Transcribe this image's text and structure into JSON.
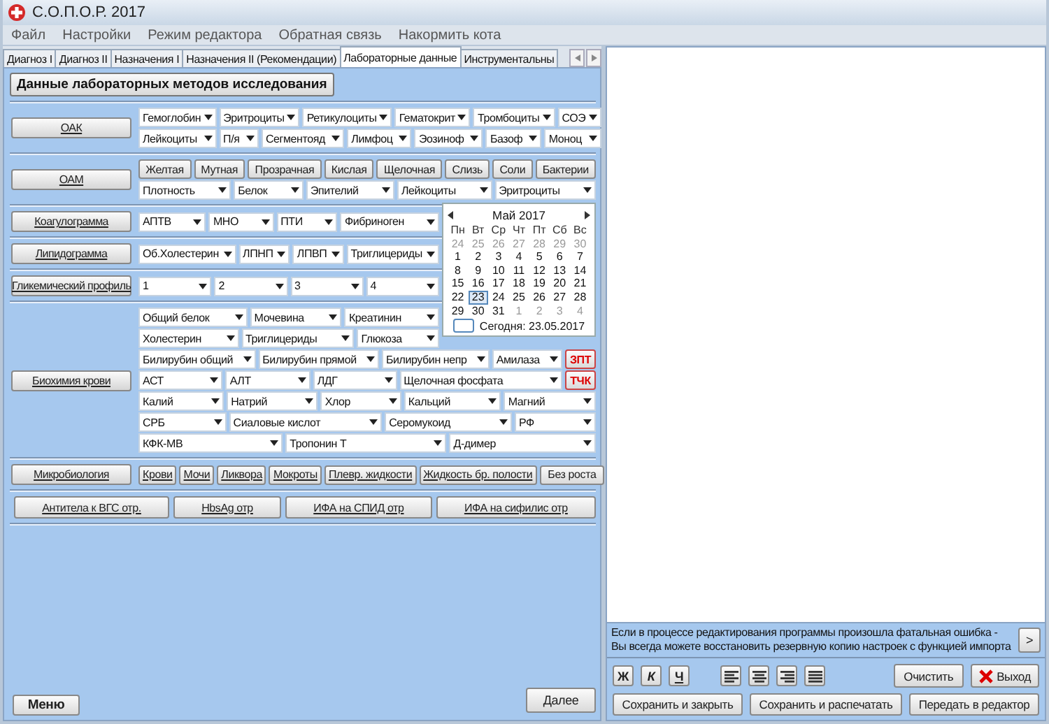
{
  "window": {
    "title": "С.О.П.О.Р. 2017"
  },
  "menu": [
    "Файл",
    "Настройки",
    "Режим редактора",
    "Обратная связь",
    "Накормить кота"
  ],
  "tabs": [
    {
      "label": "Диагноз I",
      "selected": false
    },
    {
      "label": "Диагноз II",
      "selected": false
    },
    {
      "label": "Назначения I",
      "selected": false
    },
    {
      "label": "Назначения II (Рекомендации)",
      "selected": false
    },
    {
      "label": "Лабораторные данные",
      "selected": true
    },
    {
      "label": "Инструментальны",
      "selected": false
    }
  ],
  "section_title": "Данные лабораторных методов исследования",
  "groups": [
    {
      "label": "ОАК",
      "rows": [
        {
          "items": [
            {
              "kind": "combo",
              "value": "Гемоглобин"
            },
            {
              "kind": "combo",
              "value": "Эритроциты"
            },
            {
              "kind": "combo",
              "value": "Ретикулоциты"
            },
            {
              "kind": "combo",
              "value": "Гематокрит"
            },
            {
              "kind": "combo",
              "value": "Тромбоциты"
            },
            {
              "kind": "combo",
              "value": "СОЭ"
            }
          ]
        },
        {
          "items": [
            {
              "kind": "combo",
              "value": "Лейкоциты"
            },
            {
              "kind": "combo",
              "value": "П/я"
            },
            {
              "kind": "combo",
              "value": "Сегментояд"
            },
            {
              "kind": "combo",
              "value": "Лимфоц"
            },
            {
              "kind": "combo",
              "value": "Эозиноф"
            },
            {
              "kind": "combo",
              "value": "Базоф"
            },
            {
              "kind": "combo",
              "value": "Моноц"
            }
          ]
        }
      ]
    },
    {
      "label": "ОАМ",
      "rows": [
        {
          "items": [
            {
              "kind": "toggle",
              "label": "Желтая"
            },
            {
              "kind": "toggle",
              "label": "Мутная"
            },
            {
              "kind": "toggle",
              "label": "Прозрачная"
            },
            {
              "kind": "toggle",
              "label": "Кислая"
            },
            {
              "kind": "toggle",
              "label": "Щелочная"
            },
            {
              "kind": "toggle",
              "label": "Слизь"
            },
            {
              "kind": "toggle",
              "label": "Соли"
            },
            {
              "kind": "toggle",
              "label": "Бактерии"
            }
          ]
        },
        {
          "items": [
            {
              "kind": "combo",
              "value": "Плотность"
            },
            {
              "kind": "combo",
              "value": "Белок"
            },
            {
              "kind": "combo",
              "value": "Эпителий"
            },
            {
              "kind": "combo",
              "value": "Лейкоциты"
            },
            {
              "kind": "combo",
              "value": "Эритроциты"
            }
          ]
        }
      ]
    },
    {
      "label": "Коагулограмма",
      "rows": [
        {
          "items": [
            {
              "kind": "combo",
              "value": "АПТВ"
            },
            {
              "kind": "combo",
              "value": "МНО"
            },
            {
              "kind": "combo",
              "value": "ПТИ"
            },
            {
              "kind": "combo",
              "value": "Фибриноген"
            }
          ]
        }
      ]
    },
    {
      "label": "Липидограмма",
      "rows": [
        {
          "items": [
            {
              "kind": "combo",
              "value": "Об.Холестерин"
            },
            {
              "kind": "combo",
              "value": "ЛПНП"
            },
            {
              "kind": "combo",
              "value": "ЛПВП"
            },
            {
              "kind": "combo",
              "value": "Триглицериды"
            }
          ]
        }
      ]
    },
    {
      "label": "Гликемический профиль",
      "rows": [
        {
          "items": [
            {
              "kind": "combo",
              "value": "1"
            },
            {
              "kind": "combo",
              "value": "2"
            },
            {
              "kind": "combo",
              "value": "3"
            },
            {
              "kind": "combo",
              "value": "4"
            }
          ]
        }
      ]
    },
    {
      "label": "Биохимия крови",
      "rows": [
        {
          "items": [
            {
              "kind": "combo",
              "value": "Общий белок"
            },
            {
              "kind": "combo",
              "value": "Мочевина"
            },
            {
              "kind": "combo",
              "value": "Креатинин"
            }
          ]
        },
        {
          "items": [
            {
              "kind": "combo",
              "value": "Холестерин"
            },
            {
              "kind": "combo",
              "value": "Триглицериды"
            },
            {
              "kind": "combo",
              "value": "Глюкоза"
            }
          ]
        },
        {
          "items": [
            {
              "kind": "combo",
              "value": "Билирубин общий"
            },
            {
              "kind": "combo",
              "value": "Билирубин прямой"
            },
            {
              "kind": "combo",
              "value": "Билирубин непр"
            },
            {
              "kind": "combo",
              "value": "Амилаза"
            },
            {
              "kind": "red_button",
              "label": "ЗПТ"
            }
          ]
        },
        {
          "items": [
            {
              "kind": "combo",
              "value": "АСТ"
            },
            {
              "kind": "combo",
              "value": "АЛТ"
            },
            {
              "kind": "combo",
              "value": "ЛДГ"
            },
            {
              "kind": "combo",
              "value": "Щелочная фосфата"
            },
            {
              "kind": "red_button",
              "label": "ТЧК"
            }
          ]
        },
        {
          "items": [
            {
              "kind": "combo",
              "value": "Калий"
            },
            {
              "kind": "combo",
              "value": "Натрий"
            },
            {
              "kind": "combo",
              "value": "Хлор"
            },
            {
              "kind": "combo",
              "value": "Кальций"
            },
            {
              "kind": "combo",
              "value": "Магний"
            }
          ]
        },
        {
          "items": [
            {
              "kind": "combo",
              "value": "СРБ"
            },
            {
              "kind": "combo",
              "value": "Сиаловые кислот"
            },
            {
              "kind": "combo",
              "value": "Серомукоид"
            },
            {
              "kind": "combo",
              "value": "РФ"
            }
          ]
        },
        {
          "items": [
            {
              "kind": "combo",
              "value": "КФК-МВ"
            },
            {
              "kind": "combo",
              "value": "Тропонин Т"
            },
            {
              "kind": "combo",
              "value": "Д-димер"
            }
          ]
        }
      ]
    },
    {
      "label": "Микробиология",
      "rows": [
        {
          "items": [
            {
              "kind": "link",
              "label": "Крови"
            },
            {
              "kind": "link",
              "label": "Мочи"
            },
            {
              "kind": "link",
              "label": "Ликвора"
            },
            {
              "kind": "link",
              "label": "Мокроты"
            },
            {
              "kind": "link",
              "label": "Плевр. жидкости"
            },
            {
              "kind": "link",
              "label": "Жидкость бр. полости"
            },
            {
              "kind": "button",
              "label": "Без роста"
            }
          ]
        }
      ]
    }
  ],
  "extra_buttons": [
    "Антитела к ВГС отр.",
    "HbsAg отр",
    "ИФА на СПИД отр",
    "ИФА на сифилис отр"
  ],
  "calendar": {
    "month": "Май 2017",
    "weekdays": [
      "Пн",
      "Вт",
      "Ср",
      "Чт",
      "Пт",
      "Сб",
      "Вс"
    ],
    "days": [
      {
        "day": "24",
        "other_month": true,
        "selected": false
      },
      {
        "day": "25",
        "other_month": true,
        "selected": false
      },
      {
        "day": "26",
        "other_month": true,
        "selected": false
      },
      {
        "day": "27",
        "other_month": true,
        "selected": false
      },
      {
        "day": "28",
        "other_month": true,
        "selected": false
      },
      {
        "day": "29",
        "other_month": true,
        "selected": false
      },
      {
        "day": "30",
        "other_month": true,
        "selected": false
      },
      {
        "day": "1",
        "other_month": false,
        "selected": false
      },
      {
        "day": "2",
        "other_month": false,
        "selected": false
      },
      {
        "day": "3",
        "other_month": false,
        "selected": false
      },
      {
        "day": "4",
        "other_month": false,
        "selected": false
      },
      {
        "day": "5",
        "other_month": false,
        "selected": false
      },
      {
        "day": "6",
        "other_month": false,
        "selected": false
      },
      {
        "day": "7",
        "other_month": false,
        "selected": false
      },
      {
        "day": "8",
        "other_month": false,
        "selected": false
      },
      {
        "day": "9",
        "other_month": false,
        "selected": false
      },
      {
        "day": "10",
        "other_month": false,
        "selected": false
      },
      {
        "day": "11",
        "other_month": false,
        "selected": false
      },
      {
        "day": "12",
        "other_month": false,
        "selected": false
      },
      {
        "day": "13",
        "other_month": false,
        "selected": false
      },
      {
        "day": "14",
        "other_month": false,
        "selected": false
      },
      {
        "day": "15",
        "other_month": false,
        "selected": false
      },
      {
        "day": "16",
        "other_month": false,
        "selected": false
      },
      {
        "day": "17",
        "other_month": false,
        "selected": false
      },
      {
        "day": "18",
        "other_month": false,
        "selected": false
      },
      {
        "day": "19",
        "other_month": false,
        "selected": false
      },
      {
        "day": "20",
        "other_month": false,
        "selected": false
      },
      {
        "day": "21",
        "other_month": false,
        "selected": false
      },
      {
        "day": "22",
        "other_month": false,
        "selected": false
      },
      {
        "day": "23",
        "other_month": false,
        "selected": true
      },
      {
        "day": "24",
        "other_month": false,
        "selected": false
      },
      {
        "day": "25",
        "other_month": false,
        "selected": false
      },
      {
        "day": "26",
        "other_month": false,
        "selected": false
      },
      {
        "day": "27",
        "other_month": false,
        "selected": false
      },
      {
        "day": "28",
        "other_month": false,
        "selected": false
      },
      {
        "day": "29",
        "other_month": false,
        "selected": false
      },
      {
        "day": "30",
        "other_month": false,
        "selected": false
      },
      {
        "day": "31",
        "other_month": false,
        "selected": false
      },
      {
        "day": "1",
        "other_month": true,
        "selected": false
      },
      {
        "day": "2",
        "other_month": true,
        "selected": false
      },
      {
        "day": "3",
        "other_month": true,
        "selected": false
      },
      {
        "day": "4",
        "other_month": true,
        "selected": false
      }
    ],
    "today": "Сегодня: 23.05.2017"
  },
  "menu_button": "Меню",
  "next_button": "Далее",
  "editor": {
    "hint": "Если в процессе редактирования программы произошла фатальная ошибка - Вы всегда можете восстановить резервную копию настроек с функцией импорта",
    "hint_button": ">",
    "format_buttons": [
      {
        "kind": "bold",
        "label": "Ж"
      },
      {
        "kind": "italic",
        "label": "К"
      },
      {
        "kind": "underline",
        "label": "Ч"
      }
    ],
    "align_buttons": [
      {
        "kind": "left"
      },
      {
        "kind": "center"
      },
      {
        "kind": "right"
      },
      {
        "kind": "justify"
      }
    ],
    "clear_button": "Очистить",
    "exit_button": "Выход",
    "bottom_buttons": [
      "Сохранить и закрыть",
      "Сохранить и распечатать",
      "Передать в редактор"
    ]
  }
}
